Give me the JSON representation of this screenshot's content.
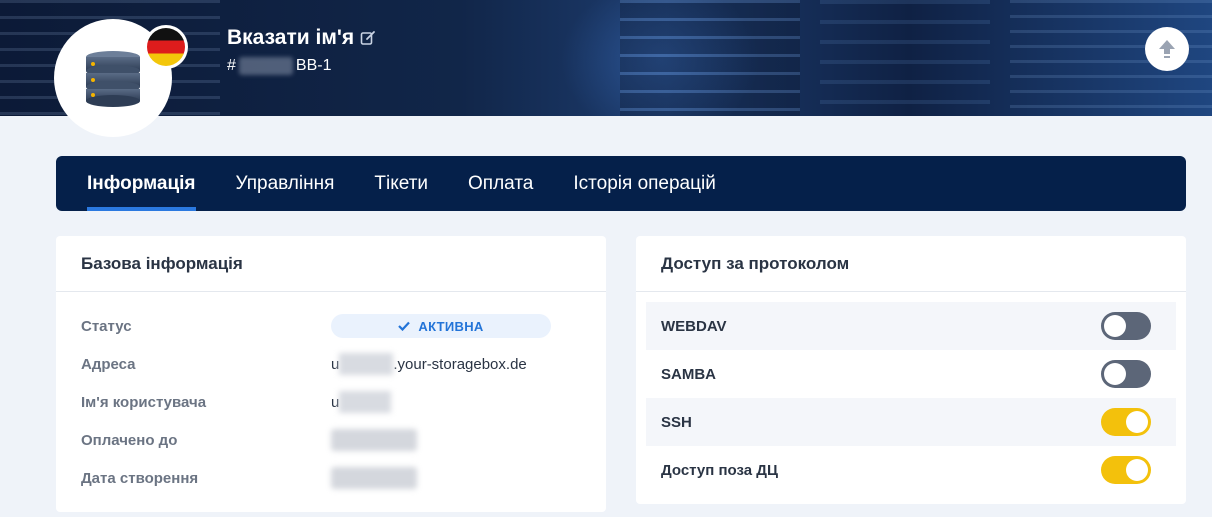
{
  "header": {
    "name": "Вказати ім'я",
    "id_prefix": "#",
    "id_suffix": "BB-1",
    "flag_country": "Germany",
    "icons": {
      "avatar": "database-icon",
      "edit": "edit-icon",
      "scroll_up": "arrow-up-icon"
    }
  },
  "tabs": [
    {
      "label": "Інформація",
      "active": true
    },
    {
      "label": "Управління",
      "active": false
    },
    {
      "label": "Тікети",
      "active": false
    },
    {
      "label": "Оплата",
      "active": false
    },
    {
      "label": "Історія операцій",
      "active": false
    }
  ],
  "basic_info": {
    "title": "Базова інформація",
    "status_label": "Статус",
    "status_value": "АКТИВНА",
    "address_label": "Адреса",
    "address_prefix": "u",
    "address_suffix": ".your-storagebox.de",
    "username_label": "Ім'я користувача",
    "username_prefix": "u",
    "paid_until_label": "Оплачено до",
    "created_label": "Дата створення"
  },
  "protocol_access": {
    "title": "Доступ за протоколом",
    "items": [
      {
        "label": "WEBDAV",
        "enabled": false
      },
      {
        "label": "SAMBA",
        "enabled": false
      },
      {
        "label": "SSH",
        "enabled": true
      },
      {
        "label": "Доступ поза ДЦ",
        "enabled": true
      }
    ]
  },
  "colors": {
    "tab_bar": "#05204a",
    "tab_underline": "#2b79e0",
    "toggle_on": "#f3c10c",
    "toggle_off": "#5c6678",
    "status_text": "#2374d8"
  }
}
